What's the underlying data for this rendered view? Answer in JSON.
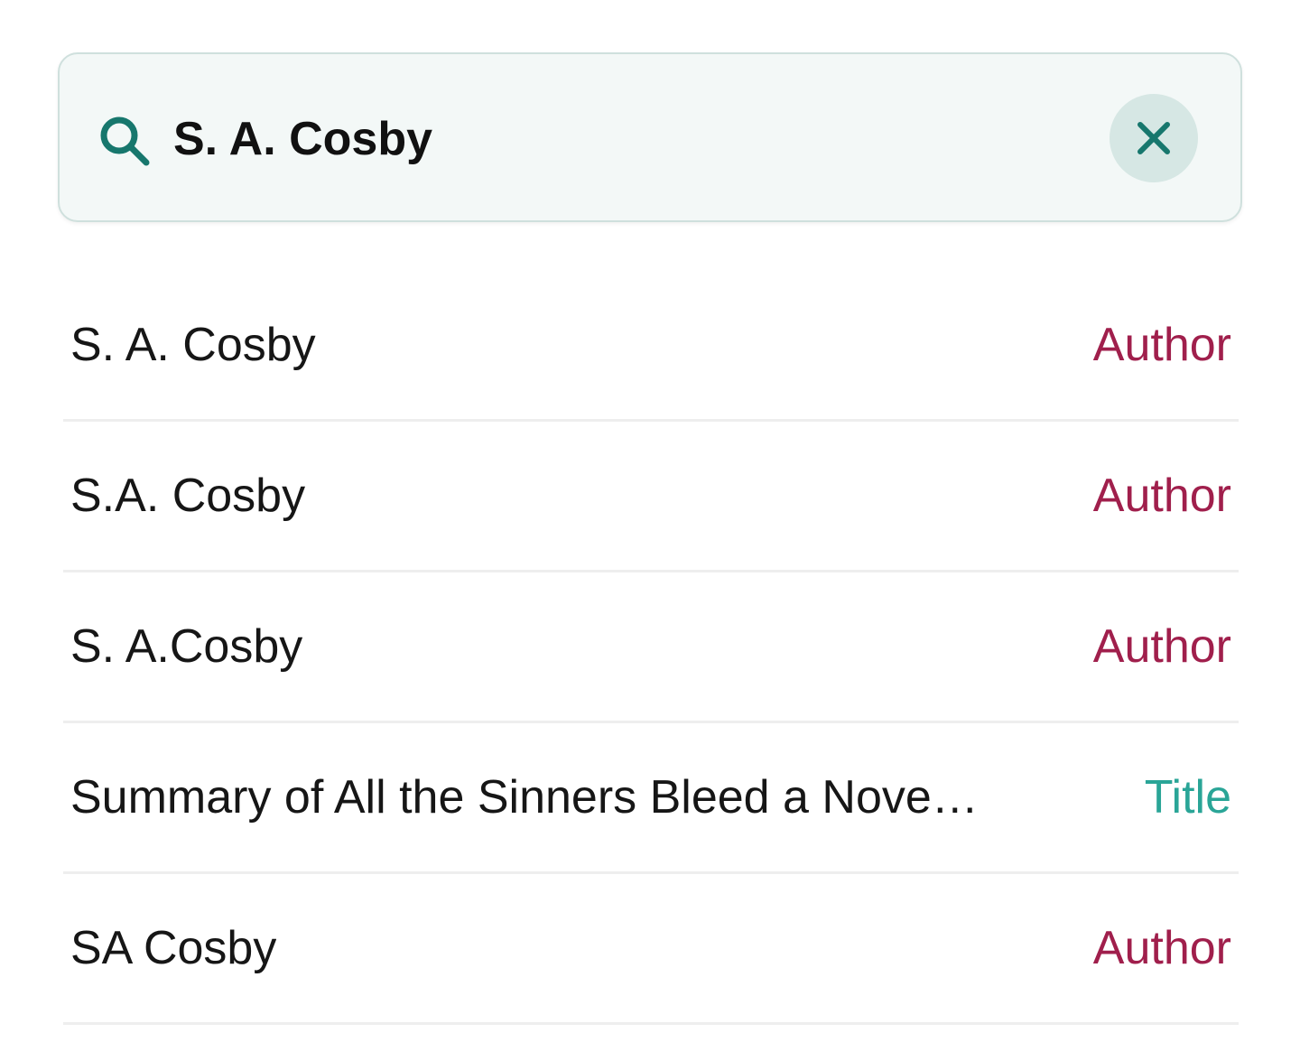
{
  "search": {
    "value": "S. A. Cosby",
    "icon": "search-icon",
    "clear_icon": "close-icon"
  },
  "colors": {
    "accent": "#17776d",
    "author": "#a01f4c",
    "title": "#2aa597",
    "search_bg": "#f3f8f7",
    "clear_bg": "#d6e7e4"
  },
  "results": [
    {
      "name": "S. A. Cosby",
      "type": "Author",
      "kind": "author"
    },
    {
      "name": "S.A. Cosby",
      "type": "Author",
      "kind": "author"
    },
    {
      "name": "S. A.Cosby",
      "type": "Author",
      "kind": "author"
    },
    {
      "name": "Summary of All the Sinners Bleed a Nove…",
      "type": "Title",
      "kind": "title"
    },
    {
      "name": "SA Cosby",
      "type": "Author",
      "kind": "author"
    }
  ]
}
